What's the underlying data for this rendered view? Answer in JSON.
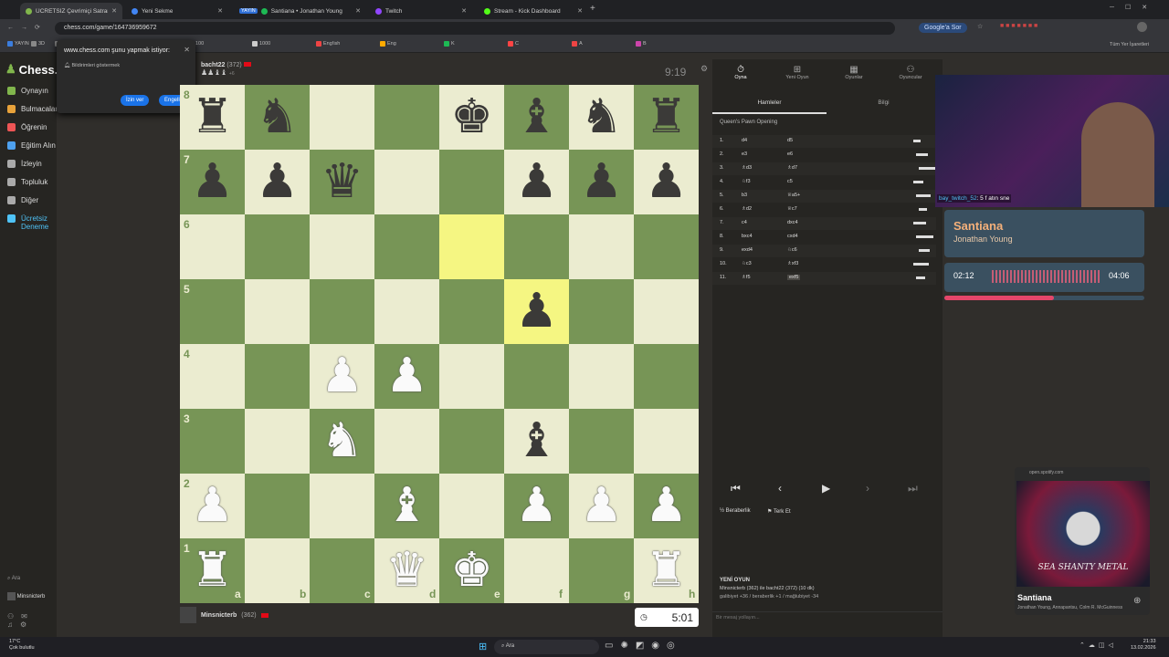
{
  "tabs": [
    {
      "label": "ÜCRETSİZ Çevrimiçi Satranç Oy...",
      "color": "#81b64c",
      "active": true
    },
    {
      "label": "Yeni Sekme",
      "color": "#4285f4"
    },
    {
      "label": "Santiana • Jonathan Young",
      "color": "#1db954",
      "badge": "YAYIN"
    },
    {
      "label": "Twitch",
      "color": "#9146ff"
    },
    {
      "label": "Stream - Kick Dashboard",
      "color": "#53fc18"
    }
  ],
  "browser": {
    "url": "chess.com/game/164736959672",
    "ask_google": "Google'a Sor",
    "all_bookmarks": "Tüm Yer İşaretleri",
    "bookmark_items": [
      "YAYIN",
      "3D",
      "SP",
      "P",
      "S",
      "H",
      "100",
      "1000",
      "Eng!ish",
      "Eng",
      "K",
      "C",
      "A",
      "B"
    ]
  },
  "notification": {
    "title": "www.chess.com şunu yapmak istiyor:",
    "item": "Bildirimleri göstermek",
    "allow": "İzin ver",
    "block": "Engelle"
  },
  "sidebar": {
    "logo": "Chess.com",
    "items": [
      "Oynayın",
      "Bulmacalar",
      "Öğrenin",
      "Eğitim Alın",
      "İzleyin",
      "Topluluk",
      "Diğer",
      "Ücretsiz Deneme"
    ],
    "search": "Ara",
    "user": "Minsnicterb"
  },
  "top_player": {
    "name": "bacht22",
    "rating": "(372)",
    "captured": "+6",
    "clock": "9:19"
  },
  "bottom_player": {
    "name": "Minsnicterb",
    "rating": "(362)",
    "clock": "5:01"
  },
  "board": {
    "ranks": [
      "8",
      "7",
      "6",
      "5",
      "4",
      "3",
      "2",
      "1"
    ],
    "files": [
      "a",
      "b",
      "c",
      "d",
      "e",
      "f",
      "g",
      "h"
    ],
    "light": "#ebecd0",
    "dark": "#779556",
    "highlight": "#f5f682",
    "highlights": [
      "e6",
      "f5"
    ],
    "pieces": {
      "a8": "br",
      "b8": "bn",
      "e8": "bk",
      "f8": "bb",
      "g8": "bn",
      "h8": "br",
      "a7": "bp",
      "b7": "bp",
      "c7": "bq",
      "f7": "bp",
      "g7": "bp",
      "h7": "bp",
      "f5": "bp",
      "c4": "wp",
      "d4": "wp",
      "c3": "wn",
      "f3": "bb",
      "a2": "wp",
      "d2": "wb",
      "f2": "wp",
      "g2": "wp",
      "h2": "wp",
      "a1": "wr",
      "d1": "wq",
      "e1": "wk",
      "h1": "wr"
    }
  },
  "right_panel": {
    "tabs": [
      "Oyna",
      "Yeni Oyun",
      "Oyunlar",
      "Oyuncular"
    ],
    "subtabs": [
      "Hamleler",
      "Bilgi"
    ],
    "opening": "Queen's Pawn Opening",
    "moves": [
      [
        "1.",
        "d4",
        "d5"
      ],
      [
        "2.",
        "e3",
        "e6"
      ],
      [
        "3.",
        "♗d3",
        "♗d7"
      ],
      [
        "4.",
        "♘f3",
        "c5"
      ],
      [
        "5.",
        "b3",
        "♕a5+"
      ],
      [
        "6.",
        "♗d2",
        "♕c7"
      ],
      [
        "7.",
        "c4",
        "dxc4"
      ],
      [
        "8.",
        "bxc4",
        "cxd4"
      ],
      [
        "9.",
        "exd4",
        "♘c6"
      ],
      [
        "10.",
        "♘c3",
        "♗xf3"
      ],
      [
        "11.",
        "♗f5",
        "exf5"
      ]
    ],
    "draw": "Beraberlik",
    "resign": "Terk Et",
    "new_game_title": "YENİ OYUN",
    "new_game_line1": "Minsnicterb (362) ile bacht22 (372) (10 dk)",
    "new_game_line2": "galibiyet +36 / beraberlik +1 / mağlubiyet -34",
    "chat_placeholder": "Bir mesaj yollayın..."
  },
  "stream": {
    "chat_user": "bay_twitch_52",
    "chat_msg": ": 5 f atın sne",
    "song": "Santiana",
    "artist": "Jonathan Young",
    "elapsed": "02:12",
    "total": "04:06",
    "progress": 0.55,
    "spotify_url": "open.spotify.com",
    "card_title": "Santiana",
    "card_artists": "Jonathan Young, Annapantsu, Colm R. McGuinness",
    "album_text": "SEA SHANTY METAL"
  },
  "taskbar": {
    "weather_temp": "17°C",
    "weather_desc": "Çok bulutlu",
    "search": "Ara",
    "time": "21:33",
    "date": "13.02.2026"
  }
}
